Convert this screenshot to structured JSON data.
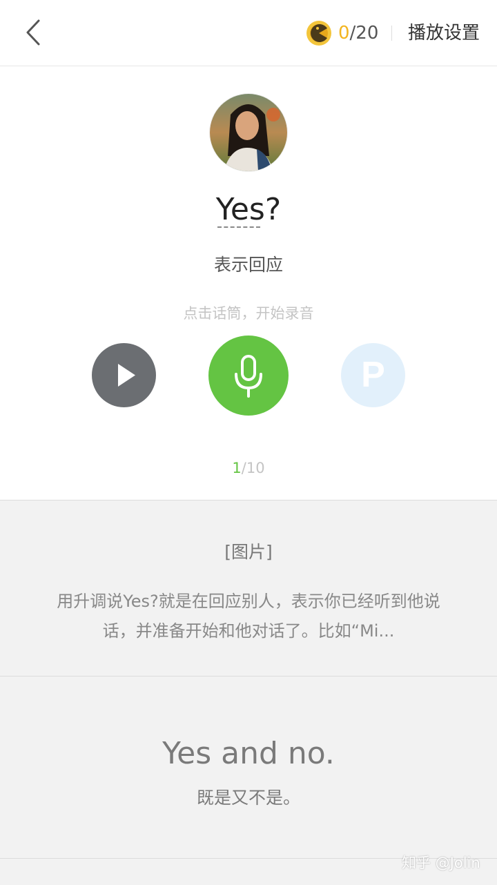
{
  "header": {
    "score_current": "0",
    "score_total": "/20",
    "settings_label": "播放设置"
  },
  "card": {
    "word": "Yes?",
    "meaning": "表示回应",
    "hint": "点击话筒，开始录音",
    "p_button_letter": "P",
    "progress_current": "1",
    "progress_total": "/10"
  },
  "detail": {
    "image_tag": "[图片]",
    "description": "用升调说Yes?就是在回应别人，表示你已经听到他说话，并准备开始和他对话了。比如“Mi...",
    "example_en": "Yes and no.",
    "example_zh": "既是又不是。"
  },
  "watermark": "知乎 @Jolin",
  "colors": {
    "accent_green": "#64c443",
    "coin_gold": "#f3b520",
    "play_gray": "#6b6e72",
    "p_button_light_blue": "#e2f0fb"
  },
  "icons": {
    "back": "chevron-left-icon",
    "coin": "coin-icon",
    "play": "play-icon",
    "mic": "microphone-icon"
  }
}
